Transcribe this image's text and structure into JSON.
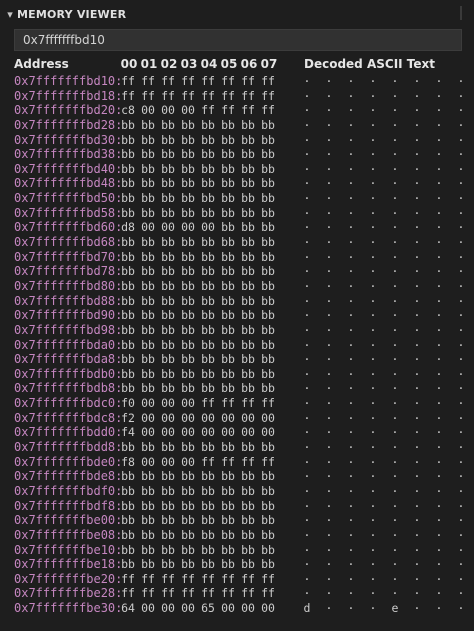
{
  "panel": {
    "title": "MEMORY VIEWER",
    "collapse_icon": "chevron-down-icon"
  },
  "address_input": {
    "value": "0x7fffffffbd10"
  },
  "table": {
    "address_header": "Address",
    "byte_headers": [
      "00",
      "01",
      "02",
      "03",
      "04",
      "05",
      "06",
      "07"
    ],
    "ascii_header": "Decoded ASCII Text",
    "rows": [
      {
        "address": "0x7fffffffbd10:",
        "bytes": [
          "ff",
          "ff",
          "ff",
          "ff",
          "ff",
          "ff",
          "ff",
          "ff"
        ],
        "ascii": [
          "·",
          "·",
          "·",
          "·",
          "·",
          "·",
          "·",
          "·"
        ]
      },
      {
        "address": "0x7fffffffbd18:",
        "bytes": [
          "ff",
          "ff",
          "ff",
          "ff",
          "ff",
          "ff",
          "ff",
          "ff"
        ],
        "ascii": [
          "·",
          "·",
          "·",
          "·",
          "·",
          "·",
          "·",
          "·"
        ]
      },
      {
        "address": "0x7fffffffbd20:",
        "bytes": [
          "c8",
          "00",
          "00",
          "00",
          "ff",
          "ff",
          "ff",
          "ff"
        ],
        "ascii": [
          "·",
          "·",
          "·",
          "·",
          "·",
          "·",
          "·",
          "·"
        ]
      },
      {
        "address": "0x7fffffffbd28:",
        "bytes": [
          "bb",
          "bb",
          "bb",
          "bb",
          "bb",
          "bb",
          "bb",
          "bb"
        ],
        "ascii": [
          "·",
          "·",
          "·",
          "·",
          "·",
          "·",
          "·",
          "·"
        ]
      },
      {
        "address": "0x7fffffffbd30:",
        "bytes": [
          "bb",
          "bb",
          "bb",
          "bb",
          "bb",
          "bb",
          "bb",
          "bb"
        ],
        "ascii": [
          "·",
          "·",
          "·",
          "·",
          "·",
          "·",
          "·",
          "·"
        ]
      },
      {
        "address": "0x7fffffffbd38:",
        "bytes": [
          "bb",
          "bb",
          "bb",
          "bb",
          "bb",
          "bb",
          "bb",
          "bb"
        ],
        "ascii": [
          "·",
          "·",
          "·",
          "·",
          "·",
          "·",
          "·",
          "·"
        ]
      },
      {
        "address": "0x7fffffffbd40:",
        "bytes": [
          "bb",
          "bb",
          "bb",
          "bb",
          "bb",
          "bb",
          "bb",
          "bb"
        ],
        "ascii": [
          "·",
          "·",
          "·",
          "·",
          "·",
          "·",
          "·",
          "·"
        ]
      },
      {
        "address": "0x7fffffffbd48:",
        "bytes": [
          "bb",
          "bb",
          "bb",
          "bb",
          "bb",
          "bb",
          "bb",
          "bb"
        ],
        "ascii": [
          "·",
          "·",
          "·",
          "·",
          "·",
          "·",
          "·",
          "·"
        ]
      },
      {
        "address": "0x7fffffffbd50:",
        "bytes": [
          "bb",
          "bb",
          "bb",
          "bb",
          "bb",
          "bb",
          "bb",
          "bb"
        ],
        "ascii": [
          "·",
          "·",
          "·",
          "·",
          "·",
          "·",
          "·",
          "·"
        ]
      },
      {
        "address": "0x7fffffffbd58:",
        "bytes": [
          "bb",
          "bb",
          "bb",
          "bb",
          "bb",
          "bb",
          "bb",
          "bb"
        ],
        "ascii": [
          "·",
          "·",
          "·",
          "·",
          "·",
          "·",
          "·",
          "·"
        ]
      },
      {
        "address": "0x7fffffffbd60:",
        "bytes": [
          "d8",
          "00",
          "00",
          "00",
          "00",
          "bb",
          "bb",
          "bb"
        ],
        "ascii": [
          "·",
          "·",
          "·",
          "·",
          "·",
          "·",
          "·",
          "·"
        ]
      },
      {
        "address": "0x7fffffffbd68:",
        "bytes": [
          "bb",
          "bb",
          "bb",
          "bb",
          "bb",
          "bb",
          "bb",
          "bb"
        ],
        "ascii": [
          "·",
          "·",
          "·",
          "·",
          "·",
          "·",
          "·",
          "·"
        ]
      },
      {
        "address": "0x7fffffffbd70:",
        "bytes": [
          "bb",
          "bb",
          "bb",
          "bb",
          "bb",
          "bb",
          "bb",
          "bb"
        ],
        "ascii": [
          "·",
          "·",
          "·",
          "·",
          "·",
          "·",
          "·",
          "·"
        ]
      },
      {
        "address": "0x7fffffffbd78:",
        "bytes": [
          "bb",
          "bb",
          "bb",
          "bb",
          "bb",
          "bb",
          "bb",
          "bb"
        ],
        "ascii": [
          "·",
          "·",
          "·",
          "·",
          "·",
          "·",
          "·",
          "·"
        ]
      },
      {
        "address": "0x7fffffffbd80:",
        "bytes": [
          "bb",
          "bb",
          "bb",
          "bb",
          "bb",
          "bb",
          "bb",
          "bb"
        ],
        "ascii": [
          "·",
          "·",
          "·",
          "·",
          "·",
          "·",
          "·",
          "·"
        ]
      },
      {
        "address": "0x7fffffffbd88:",
        "bytes": [
          "bb",
          "bb",
          "bb",
          "bb",
          "bb",
          "bb",
          "bb",
          "bb"
        ],
        "ascii": [
          "·",
          "·",
          "·",
          "·",
          "·",
          "·",
          "·",
          "·"
        ]
      },
      {
        "address": "0x7fffffffbd90:",
        "bytes": [
          "bb",
          "bb",
          "bb",
          "bb",
          "bb",
          "bb",
          "bb",
          "bb"
        ],
        "ascii": [
          "·",
          "·",
          "·",
          "·",
          "·",
          "·",
          "·",
          "·"
        ]
      },
      {
        "address": "0x7fffffffbd98:",
        "bytes": [
          "bb",
          "bb",
          "bb",
          "bb",
          "bb",
          "bb",
          "bb",
          "bb"
        ],
        "ascii": [
          "·",
          "·",
          "·",
          "·",
          "·",
          "·",
          "·",
          "·"
        ]
      },
      {
        "address": "0x7fffffffbda0:",
        "bytes": [
          "bb",
          "bb",
          "bb",
          "bb",
          "bb",
          "bb",
          "bb",
          "bb"
        ],
        "ascii": [
          "·",
          "·",
          "·",
          "·",
          "·",
          "·",
          "·",
          "·"
        ]
      },
      {
        "address": "0x7fffffffbda8:",
        "bytes": [
          "bb",
          "bb",
          "bb",
          "bb",
          "bb",
          "bb",
          "bb",
          "bb"
        ],
        "ascii": [
          "·",
          "·",
          "·",
          "·",
          "·",
          "·",
          "·",
          "·"
        ]
      },
      {
        "address": "0x7fffffffbdb0:",
        "bytes": [
          "bb",
          "bb",
          "bb",
          "bb",
          "bb",
          "bb",
          "bb",
          "bb"
        ],
        "ascii": [
          "·",
          "·",
          "·",
          "·",
          "·",
          "·",
          "·",
          "·"
        ]
      },
      {
        "address": "0x7fffffffbdb8:",
        "bytes": [
          "bb",
          "bb",
          "bb",
          "bb",
          "bb",
          "bb",
          "bb",
          "bb"
        ],
        "ascii": [
          "·",
          "·",
          "·",
          "·",
          "·",
          "·",
          "·",
          "·"
        ]
      },
      {
        "address": "0x7fffffffbdc0:",
        "bytes": [
          "f0",
          "00",
          "00",
          "00",
          "ff",
          "ff",
          "ff",
          "ff"
        ],
        "ascii": [
          "·",
          "·",
          "·",
          "·",
          "·",
          "·",
          "·",
          "·"
        ]
      },
      {
        "address": "0x7fffffffbdc8:",
        "bytes": [
          "f2",
          "00",
          "00",
          "00",
          "00",
          "00",
          "00",
          "00"
        ],
        "ascii": [
          "·",
          "·",
          "·",
          "·",
          "·",
          "·",
          "·",
          "·"
        ]
      },
      {
        "address": "0x7fffffffbdd0:",
        "bytes": [
          "f4",
          "00",
          "00",
          "00",
          "00",
          "00",
          "00",
          "00"
        ],
        "ascii": [
          "·",
          "·",
          "·",
          "·",
          "·",
          "·",
          "·",
          "·"
        ]
      },
      {
        "address": "0x7fffffffbdd8:",
        "bytes": [
          "bb",
          "bb",
          "bb",
          "bb",
          "bb",
          "bb",
          "bb",
          "bb"
        ],
        "ascii": [
          "·",
          "·",
          "·",
          "·",
          "·",
          "·",
          "·",
          "·"
        ]
      },
      {
        "address": "0x7fffffffbde0:",
        "bytes": [
          "f8",
          "00",
          "00",
          "00",
          "ff",
          "ff",
          "ff",
          "ff"
        ],
        "ascii": [
          "·",
          "·",
          "·",
          "·",
          "·",
          "·",
          "·",
          "·"
        ]
      },
      {
        "address": "0x7fffffffbde8:",
        "bytes": [
          "bb",
          "bb",
          "bb",
          "bb",
          "bb",
          "bb",
          "bb",
          "bb"
        ],
        "ascii": [
          "·",
          "·",
          "·",
          "·",
          "·",
          "·",
          "·",
          "·"
        ]
      },
      {
        "address": "0x7fffffffbdf0:",
        "bytes": [
          "bb",
          "bb",
          "bb",
          "bb",
          "bb",
          "bb",
          "bb",
          "bb"
        ],
        "ascii": [
          "·",
          "·",
          "·",
          "·",
          "·",
          "·",
          "·",
          "·"
        ]
      },
      {
        "address": "0x7fffffffbdf8:",
        "bytes": [
          "bb",
          "bb",
          "bb",
          "bb",
          "bb",
          "bb",
          "bb",
          "bb"
        ],
        "ascii": [
          "·",
          "·",
          "·",
          "·",
          "·",
          "·",
          "·",
          "·"
        ]
      },
      {
        "address": "0x7fffffffbe00:",
        "bytes": [
          "bb",
          "bb",
          "bb",
          "bb",
          "bb",
          "bb",
          "bb",
          "bb"
        ],
        "ascii": [
          "·",
          "·",
          "·",
          "·",
          "·",
          "·",
          "·",
          "·"
        ]
      },
      {
        "address": "0x7fffffffbe08:",
        "bytes": [
          "bb",
          "bb",
          "bb",
          "bb",
          "bb",
          "bb",
          "bb",
          "bb"
        ],
        "ascii": [
          "·",
          "·",
          "·",
          "·",
          "·",
          "·",
          "·",
          "·"
        ]
      },
      {
        "address": "0x7fffffffbe10:",
        "bytes": [
          "bb",
          "bb",
          "bb",
          "bb",
          "bb",
          "bb",
          "bb",
          "bb"
        ],
        "ascii": [
          "·",
          "·",
          "·",
          "·",
          "·",
          "·",
          "·",
          "·"
        ]
      },
      {
        "address": "0x7fffffffbe18:",
        "bytes": [
          "bb",
          "bb",
          "bb",
          "bb",
          "bb",
          "bb",
          "bb",
          "bb"
        ],
        "ascii": [
          "·",
          "·",
          "·",
          "·",
          "·",
          "·",
          "·",
          "·"
        ]
      },
      {
        "address": "0x7fffffffbe20:",
        "bytes": [
          "ff",
          "ff",
          "ff",
          "ff",
          "ff",
          "ff",
          "ff",
          "ff"
        ],
        "ascii": [
          "·",
          "·",
          "·",
          "·",
          "·",
          "·",
          "·",
          "·"
        ]
      },
      {
        "address": "0x7fffffffbe28:",
        "bytes": [
          "ff",
          "ff",
          "ff",
          "ff",
          "ff",
          "ff",
          "ff",
          "ff"
        ],
        "ascii": [
          "·",
          "·",
          "·",
          "·",
          "·",
          "·",
          "·",
          "·"
        ]
      },
      {
        "address": "0x7fffffffbe30:",
        "bytes": [
          "64",
          "00",
          "00",
          "00",
          "65",
          "00",
          "00",
          "00"
        ],
        "ascii": [
          "d",
          "·",
          "·",
          "·",
          "e",
          "·",
          "·",
          "·"
        ]
      }
    ]
  },
  "colors": {
    "address": "#c586c0",
    "background": "#1e1e1e",
    "text": "#cccccc"
  }
}
